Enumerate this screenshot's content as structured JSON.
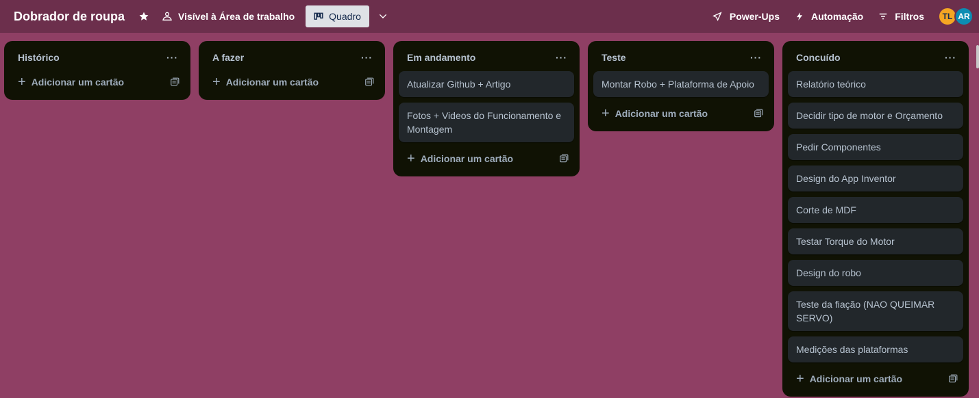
{
  "header": {
    "board_title": "Dobrador de roupa",
    "visibility_label": "Visível à Área de trabalho",
    "view_label": "Quadro",
    "powerups_label": "Power-Ups",
    "automation_label": "Automação",
    "filters_label": "Filtros",
    "avatars": [
      "TL",
      "AR"
    ]
  },
  "add_card_label": "Adicionar um cartão",
  "lists": [
    {
      "title": "Histórico",
      "cards": []
    },
    {
      "title": "A fazer",
      "cards": []
    },
    {
      "title": "Em andamento",
      "cards": [
        "Atualizar Github + Artigo",
        "Fotos + Videos do Funcionamento e Montagem"
      ]
    },
    {
      "title": "Teste",
      "cards": [
        "Montar Robo + Plataforma de Apoio"
      ]
    },
    {
      "title": "Concuído",
      "cards": [
        "Relatório teórico",
        "Decidir tipo de motor e Orçamento",
        "Pedir Componentes",
        "Design do App Inventor",
        "Corte de MDF",
        "Testar Torque do Motor",
        "Design do robo",
        "Teste da fiação (NAO QUEIMAR SERVO)",
        "Medições das plataformas"
      ]
    }
  ]
}
